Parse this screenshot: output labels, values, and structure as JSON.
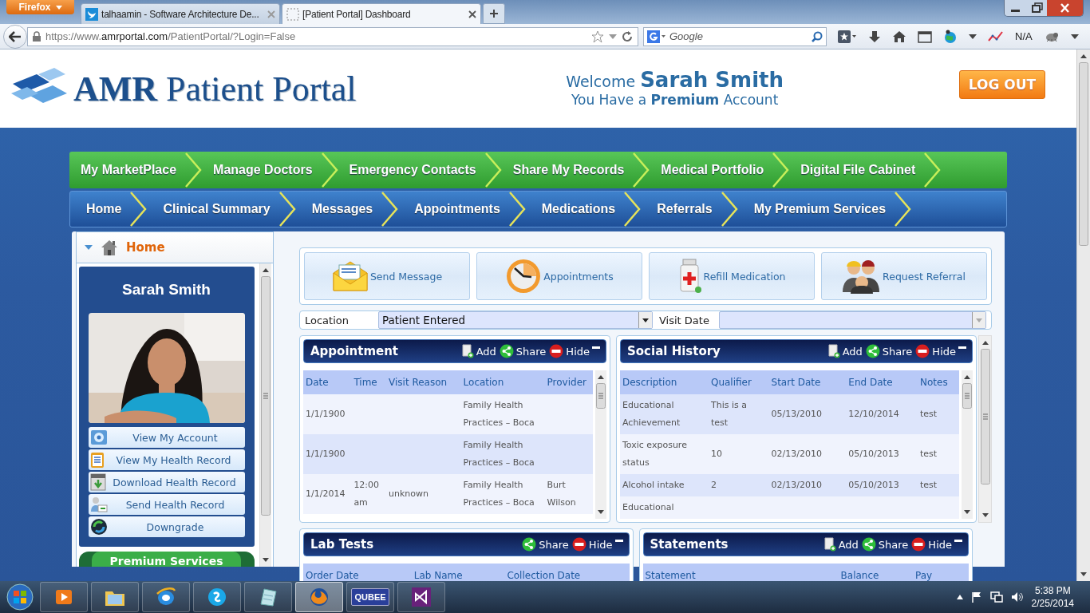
{
  "browser": {
    "menu_button": "Firefox",
    "tabs": [
      {
        "label": "talhaamin - Software Architecture De...",
        "selected": false
      },
      {
        "label": "[Patient Portal] Dashboard",
        "selected": true
      }
    ],
    "url": {
      "scheme": "https://www.",
      "domain": "amrportal.com",
      "path": "/PatientPortal/?Login=False"
    },
    "search": {
      "placeholder": "Google"
    },
    "addon_label": "N/A"
  },
  "header": {
    "logo": {
      "initials": "AMR",
      "rest": "Patient Portal"
    },
    "welcome": "Welcome",
    "user_name": "Sarah Smith",
    "account_line": "You Have a **Premium** Account",
    "logout": "LOG OUT"
  },
  "nav_primary": [
    "My MarketPlace",
    "Manage Doctors",
    "Emergency Contacts",
    "Share My Records",
    "Medical Portfolio",
    "Digital File Cabinet"
  ],
  "nav_secondary": [
    "Home",
    "Clinical Summary",
    "Messages",
    "Appointments",
    "Medications",
    "Referrals",
    "My Premium Services"
  ],
  "sidebar": {
    "title": "Home",
    "profile_name": "Sarah Smith",
    "photo": {
      "kind": "picture"
    },
    "menu": [
      "View My Account",
      "View My Health Record",
      "Download Health Record",
      "Send Health Record",
      "Downgrade"
    ],
    "premium_tab": "Premium Services"
  },
  "quick_actions": [
    "Send Message",
    "Appointments",
    "Refill Medication",
    "Request Referral"
  ],
  "filters": {
    "location_label": "Location",
    "location_value": "Patient Entered",
    "visit_date_label": "Visit Date"
  },
  "panels": [
    {
      "title": "Appointment",
      "actions": [
        {
          "kind": "add",
          "label": "Add"
        },
        {
          "kind": "share",
          "label": "Share"
        },
        {
          "kind": "hide",
          "label": "Hide"
        }
      ],
      "columns": [
        "Date",
        "Time",
        "Visit Reason",
        "Location",
        "Provider"
      ],
      "rows": [
        [
          "1/1/1900",
          "",
          "",
          "Family Health Practices – Boca",
          ""
        ],
        [
          "1/1/1900",
          "",
          "",
          "Family Health Practices – Boca",
          ""
        ],
        [
          "1/1/2014",
          "12:00 am",
          "unknown",
          "Family Health Practices – Boca",
          "Burt Wilson"
        ]
      ]
    },
    {
      "title": "Social History",
      "actions": [
        {
          "kind": "add",
          "label": "Add"
        },
        {
          "kind": "share",
          "label": "Share"
        },
        {
          "kind": "hide",
          "label": "Hide"
        }
      ],
      "columns": [
        "Description",
        "Qualifier",
        "Start Date",
        "End Date",
        "Notes"
      ],
      "rows": [
        [
          "Educational Achievement",
          "This is a test",
          "05/13/2010",
          "12/10/2014",
          "test"
        ],
        [
          "Toxic exposure status",
          "10",
          "02/13/2010",
          "05/10/2013",
          "test"
        ],
        [
          "Alcohol intake",
          "2",
          "02/13/2010",
          "05/10/2013",
          "test"
        ],
        [
          "Educational",
          "",
          "",
          "",
          ""
        ]
      ]
    },
    {
      "title": "Lab Tests",
      "actions": [
        {
          "kind": "share",
          "label": "Share"
        },
        {
          "kind": "hide",
          "label": "Hide"
        }
      ],
      "columns": [
        "Order Date",
        "Lab Name",
        "Collection Date"
      ]
    },
    {
      "title": "Statements",
      "actions": [
        {
          "kind": "add",
          "label": "Add"
        },
        {
          "kind": "share",
          "label": "Share"
        },
        {
          "kind": "hide",
          "label": "Hide"
        }
      ],
      "columns": [
        "Statement",
        "Balance",
        "Pay"
      ]
    }
  ],
  "taskbar": {
    "apps": [
      {
        "selected": false
      },
      {
        "selected": false
      },
      {
        "selected": false
      },
      {
        "selected": false
      },
      {
        "selected": false
      },
      {
        "selected": true
      },
      {
        "label": "QUBEE",
        "selected": false
      },
      {
        "selected": false
      }
    ],
    "time": "5:38 PM",
    "date": "2/25/2014"
  }
}
